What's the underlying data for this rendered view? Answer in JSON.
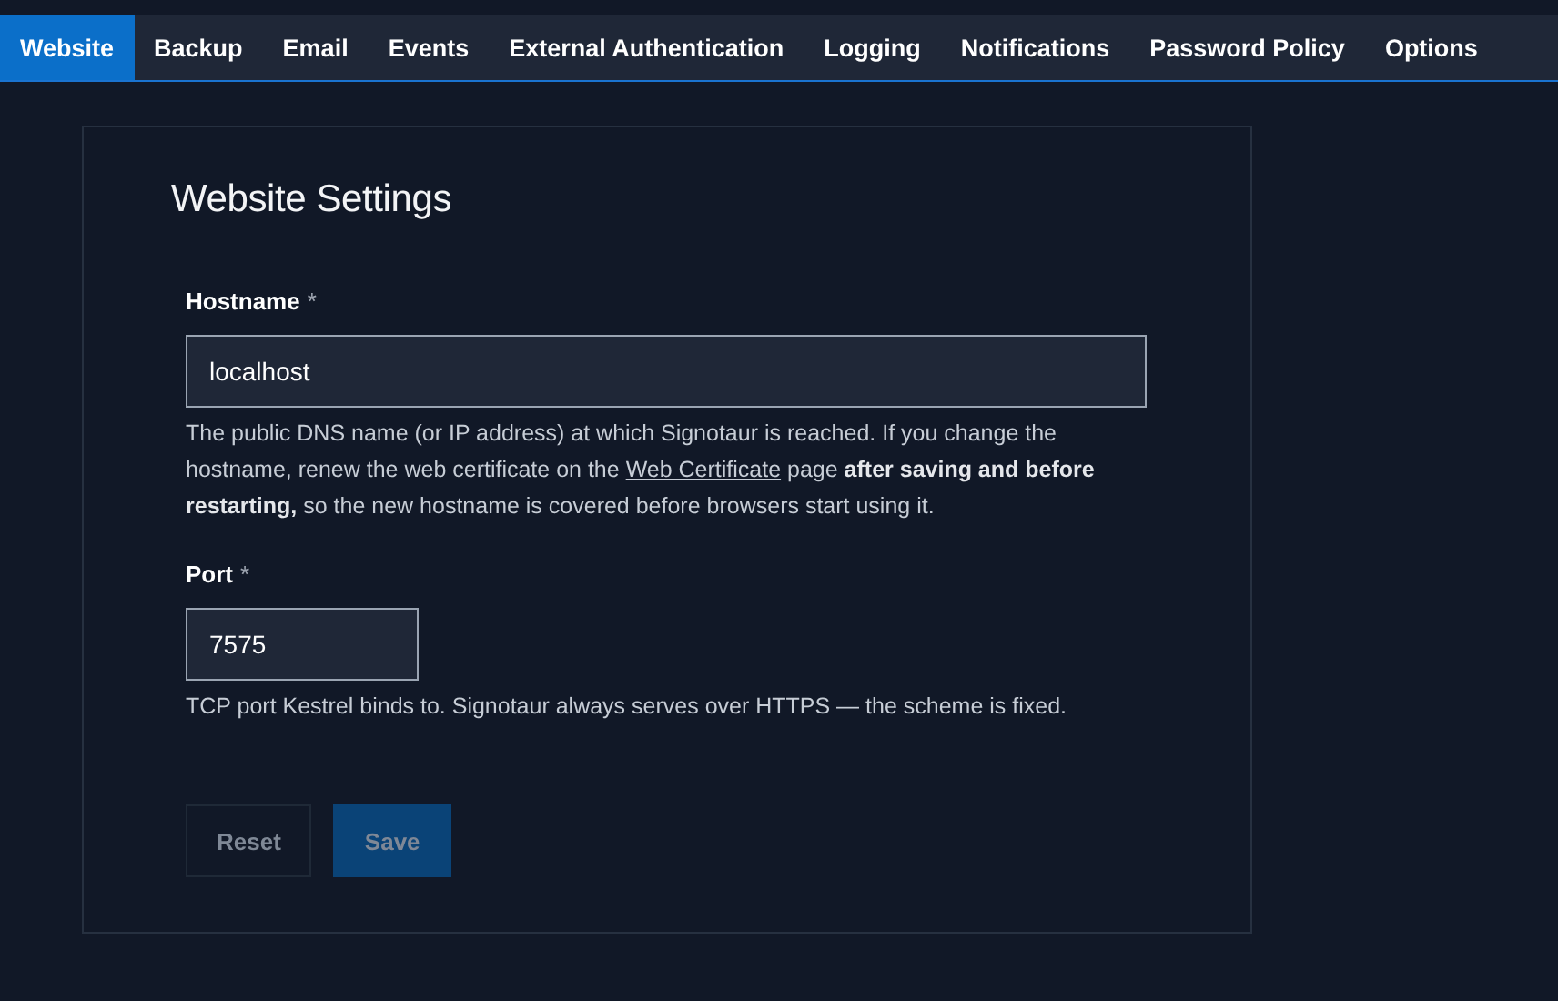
{
  "tabs": [
    {
      "label": "Website",
      "selected": true
    },
    {
      "label": "Backup",
      "selected": false
    },
    {
      "label": "Email",
      "selected": false
    },
    {
      "label": "Events",
      "selected": false
    },
    {
      "label": "External Authentication",
      "selected": false
    },
    {
      "label": "Logging",
      "selected": false
    },
    {
      "label": "Notifications",
      "selected": false
    },
    {
      "label": "Password Policy",
      "selected": false
    },
    {
      "label": "Options",
      "selected": false
    }
  ],
  "panel": {
    "title": "Website Settings",
    "fields": [
      {
        "label": "Hostname",
        "required": "*",
        "value": "localhost",
        "kind": "text",
        "help": [
          {
            "kind": "text",
            "text": "The public DNS name (or IP address) at which Signotaur is reached. If you change the hostname, renew the web certificate on the "
          },
          {
            "kind": "link",
            "text": "Web Certificate"
          },
          {
            "kind": "text",
            "text": " page **after saving and before restarting,** so the new hostname is covered before browsers start using it."
          }
        ]
      },
      {
        "label": "Port",
        "required": "*",
        "value": "7575",
        "kind": "number",
        "help": [
          {
            "kind": "text",
            "text": "TCP port Kestrel binds to. Signotaur always serves over HTTPS — the scheme is fixed."
          }
        ]
      }
    ],
    "buttons": [
      {
        "label": "Reset",
        "kind": "secondary",
        "disabled": true
      },
      {
        "label": "Save",
        "kind": "primary",
        "disabled": true
      }
    ]
  }
}
